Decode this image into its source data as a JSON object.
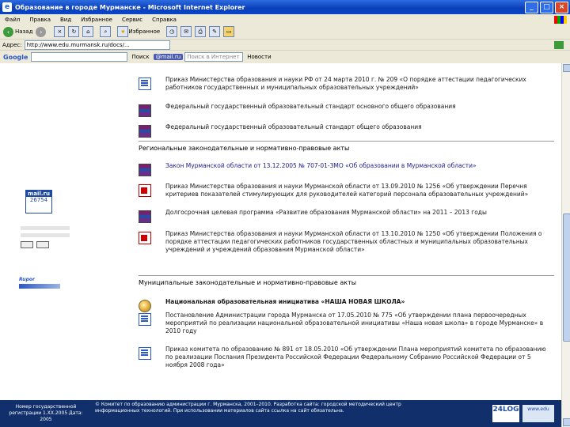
{
  "window": {
    "title": "Образование в городе Мурманске - Microsoft Internet Explorer",
    "app_icon_glyph": "e",
    "controls": [
      "_",
      "□",
      "×"
    ]
  },
  "menu": [
    "Файл",
    "Правка",
    "Вид",
    "Избранное",
    "Сервис",
    "Справка"
  ],
  "toolbar": {
    "back_label": "Назад",
    "favorites_label": "Избранное"
  },
  "address": {
    "label": "Адрес:",
    "url": "http://www.edu.murmansk.ru/docs/..."
  },
  "googlebar": {
    "logo": "Google",
    "search_label": "Поиск",
    "mail": "@mail.ru",
    "search_internet": "Поиск в Интернет",
    "news": "Новости"
  },
  "left": {
    "counter_label": "mail.ru",
    "counter_value": "26754",
    "rupor": "Rupor"
  },
  "content": {
    "items_top": [
      {
        "icon": "doc-icon",
        "text": "Приказ Министерства образования и науки РФ от 24 марта 2010 г. № 209 «О порядке аттестации педагогических работников государственных и муниципальных образовательных учреждений»"
      },
      {
        "icon": "rar-icon",
        "text": "Федеральный государственный образовательный стандарт основного общего образования"
      },
      {
        "icon": "rar-icon",
        "text": "Федеральный государственный образовательный стандарт общего образования"
      }
    ],
    "regional_heading": "Региональные законодательные и нормативно-правовые акты",
    "items_regional": [
      {
        "icon": "rar-icon",
        "text": "Закон Мурманской области от 13.12.2005 № 707-01-ЗМО «Об образовании в Мурманской области»"
      },
      {
        "icon": "pdf-icon",
        "text": "Приказ Министерства образования и науки Мурманской области от 13.09.2010 № 1256 «Об утверждении Перечня критериев показателей стимулирующих для руководителей категорий персонала образовательных учреждений»"
      },
      {
        "icon": "rar-icon",
        "text": "Долгосрочная целевая программа «Развитие образования Мурманской области» на 2011 – 2013 годы"
      },
      {
        "icon": "pdf-icon",
        "text": "Приказ Министерства образования и науки Мурманской области от 13.10.2010 № 1250 «Об утверждении Положения о порядке аттестации педагогических работников государственных областных и муниципальных образовательных учреждений и учреждений образования Мурманской области»"
      }
    ],
    "municipal_heading": "Муниципальные законодательные и нормативно-правовые акты",
    "items_municipal": [
      {
        "icon": "globe-icon",
        "text": "Национальная образовательная инициатива «НАША НОВАЯ ШКОЛА»"
      },
      {
        "icon": "doc-icon",
        "text": "Постановление Администрации города Мурманска от 17.05.2010 № 775 «Об утверждении плана первоочередных мероприятий по реализации национальной образовательной инициативы «Наша новая школа» в городе Мурманске» в 2010 году"
      },
      {
        "icon": "doc-icon",
        "text": "Приказ комитета по образованию № 891 от 18.05.2010 «Об утверждении Плана мероприятий комитета по образованию по реализации Послания Президента Российской Федерации Федеральному Собранию Российской Федерации от 5 ноября 2008 года»"
      }
    ]
  },
  "footer": {
    "left": "Номер государственной регистрации 1.ХХ.2005 Дата: 2005",
    "right": "© Комитет по образованию администрации г. Мурманска, 2001–2010. Разработка сайта: городской методический центр информационных технологий. При использовании материалов сайта ссылка на сайт обязательна.",
    "logo": "24LOG",
    "logo2": "www.edu"
  }
}
